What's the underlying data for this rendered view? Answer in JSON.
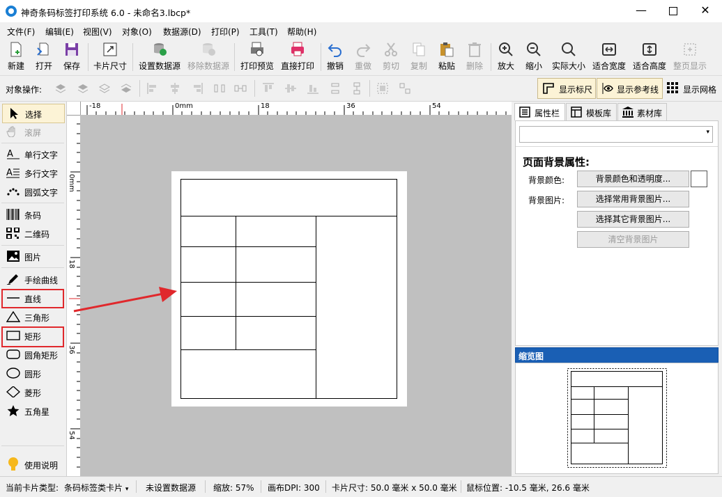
{
  "window": {
    "title": "神奇条码标签打印系统 6.0 - 未命名3.lbcp*"
  },
  "menu": [
    "文件(F)",
    "编辑(E)",
    "视图(V)",
    "对象(O)",
    "数据源(D)",
    "打印(P)",
    "工具(T)",
    "帮助(H)"
  ],
  "toolbar": {
    "new": "新建",
    "open": "打开",
    "save": "保存",
    "card_size": "卡片尺寸",
    "set_datasource": "设置数据源",
    "remove_datasource": "移除数据源",
    "print_preview": "打印预览",
    "direct_print": "直接打印",
    "undo": "撤销",
    "redo": "重做",
    "cut": "剪切",
    "copy": "复制",
    "paste": "粘贴",
    "delete": "删除",
    "zoom_in": "放大",
    "zoom_out": "缩小",
    "actual_size": "实际大小",
    "fit_width": "适合宽度",
    "fit_height": "适合高度",
    "full_page": "整页显示"
  },
  "ops": {
    "label": "对象操作:",
    "show_ruler": "显示标尺",
    "show_guides": "显示参考线",
    "show_grid": "显示网格"
  },
  "tools": {
    "select": "选择",
    "scroll": "滚屏",
    "single_text": "单行文字",
    "multi_text": "多行文字",
    "arc_text": "圆弧文字",
    "barcode": "条码",
    "qrcode": "二维码",
    "image": "图片",
    "freehand": "手绘曲线",
    "line": "直线",
    "triangle": "三角形",
    "rectangle": "矩形",
    "round_rect": "圆角矩形",
    "ellipse": "圆形",
    "diamond": "菱形",
    "star": "五角星",
    "help": "使用说明"
  },
  "ruler": {
    "h_labels": [
      "-18",
      "0mm",
      "18",
      "36",
      "54"
    ],
    "v_labels": [
      "0mm",
      "18",
      "36",
      "54"
    ]
  },
  "right_panel": {
    "tabs": [
      "属性栏",
      "模板库",
      "素材库"
    ],
    "dropdown_value": "",
    "section_title": "页面背景属性:",
    "bg_color_label": "背景颜色:",
    "bg_color_button": "背景颜色和透明度...",
    "bg_image_label": "背景图片:",
    "choose_common_image": "选择常用背景图片...",
    "choose_other_image": "选择其它背景图片...",
    "clear_image": "清空背景图片",
    "preview_title": "缩览图"
  },
  "status": {
    "card_type": "当前卡片类型:",
    "card_type_value": "条码标签类卡片",
    "datasource": "未设置数据源",
    "zoom": "缩放: 57%",
    "dpi": "画布DPI: 300",
    "card_size": "卡片尺寸: 50.0 毫米 x 50.0 毫米",
    "mouse_pos": "鼠标位置: -10.5 毫米, 26.6 毫米"
  },
  "colors": {
    "accent_blue": "#1a5fb4",
    "highlight_red": "#e0282c",
    "canvas_gray": "#c0c0c0",
    "active_tool_bg": "#fcf3d6"
  }
}
